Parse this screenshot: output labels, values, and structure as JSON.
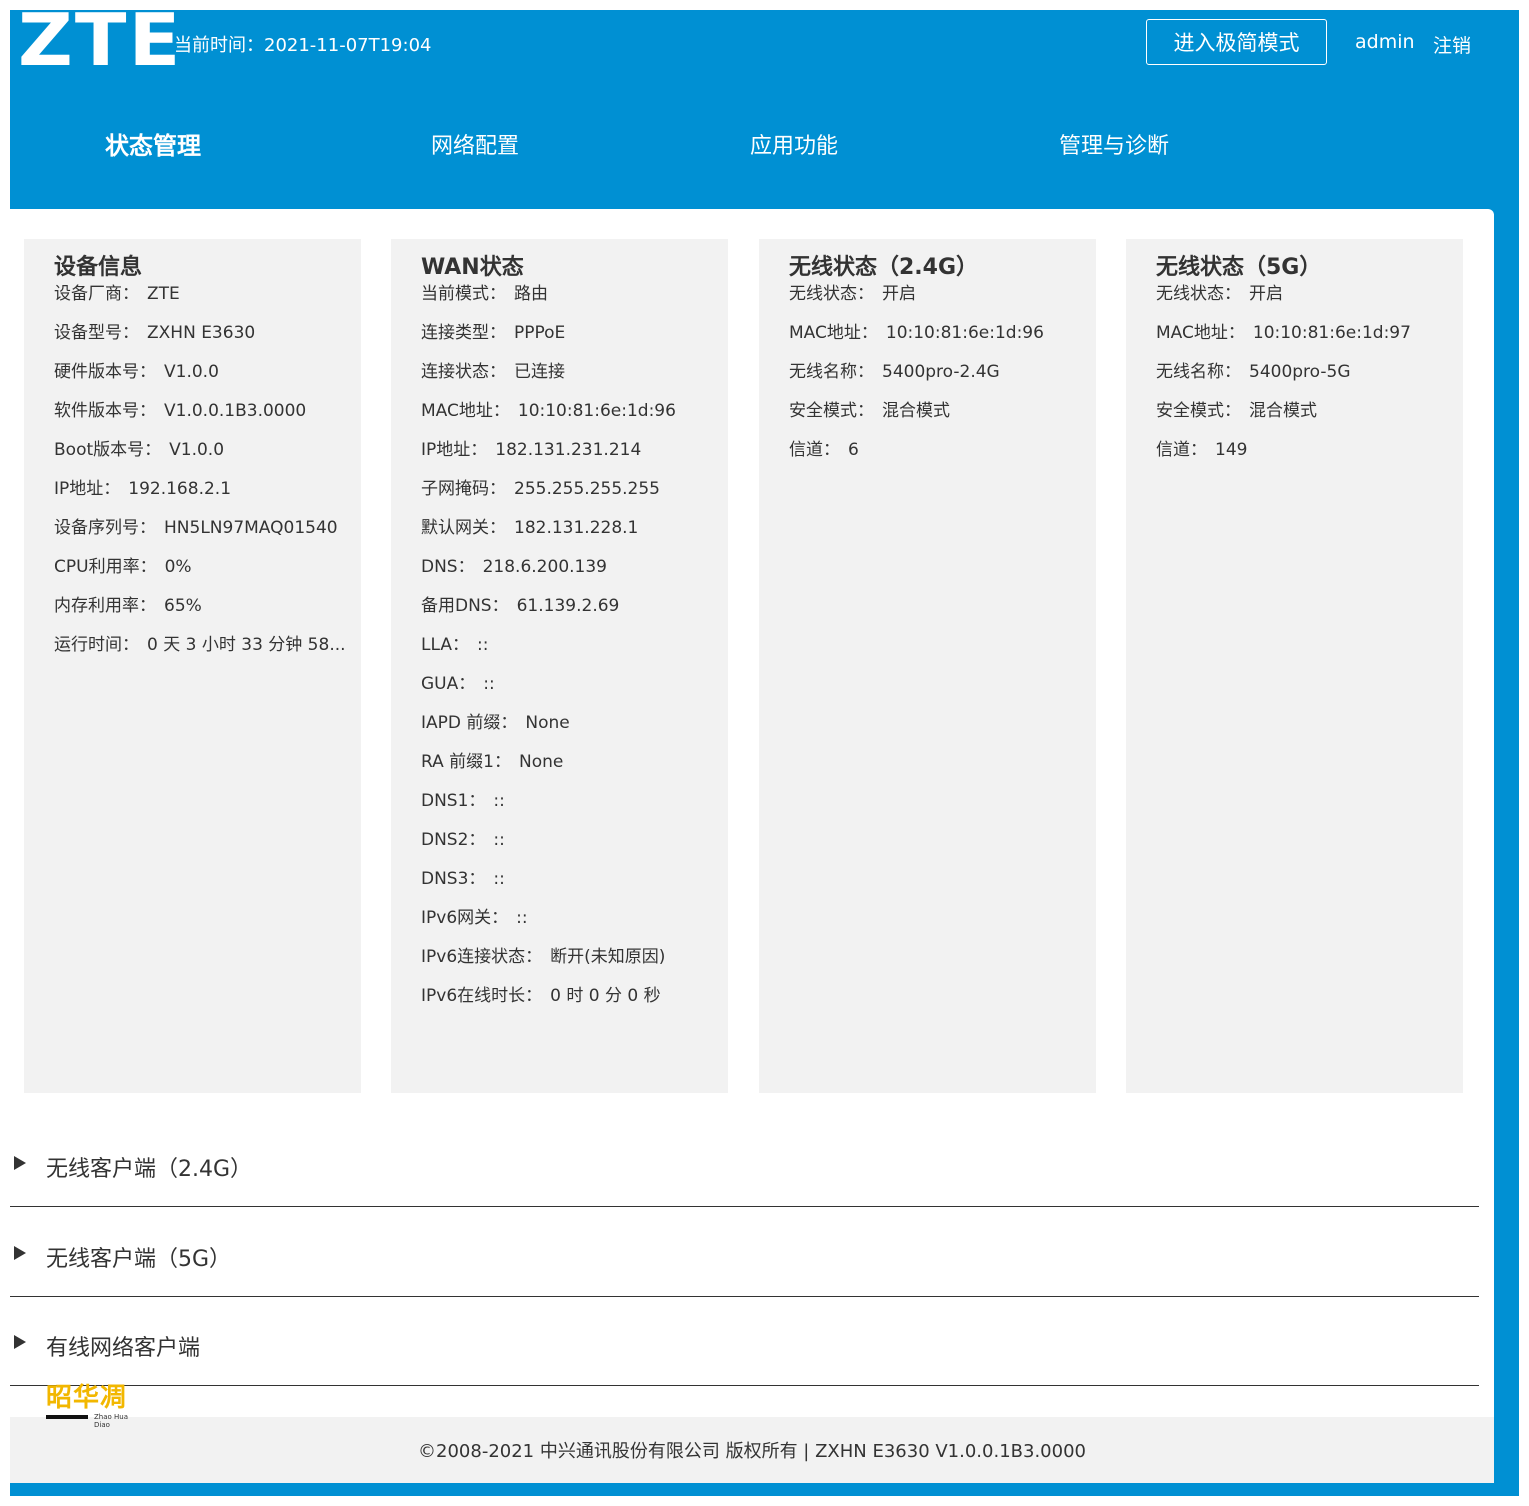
{
  "header": {
    "logo": "ZTE",
    "time_label": "当前时间：",
    "time_value": "2021-11-07T19:04",
    "simple_mode_button": "进入极简模式",
    "user": "admin",
    "logout": "注销"
  },
  "nav": [
    {
      "label": "状态管理",
      "active": true
    },
    {
      "label": "网络配置",
      "active": false
    },
    {
      "label": "应用功能",
      "active": false
    },
    {
      "label": "管理与诊断",
      "active": false
    }
  ],
  "cards": {
    "device": {
      "title": "设备信息",
      "rows": [
        {
          "label": "设备厂商：",
          "value": "ZTE"
        },
        {
          "label": "设备型号：",
          "value": "ZXHN E3630"
        },
        {
          "label": "硬件版本号：",
          "value": "V1.0.0"
        },
        {
          "label": "软件版本号：",
          "value": "V1.0.0.1B3.0000"
        },
        {
          "label": "Boot版本号：",
          "value": "V1.0.0"
        },
        {
          "label": "IP地址：",
          "value": "192.168.2.1"
        },
        {
          "label": "设备序列号：",
          "value": "HN5LN97MAQ01540"
        },
        {
          "label": "CPU利用率：",
          "value": "0%"
        },
        {
          "label": "内存利用率：",
          "value": "65%"
        },
        {
          "label": "运行时间：",
          "value": "0 天 3 小时 33 分钟 58..."
        }
      ]
    },
    "wan": {
      "title": "WAN状态",
      "rows": [
        {
          "label": "当前模式：",
          "value": "路由"
        },
        {
          "label": "连接类型：",
          "value": "PPPoE"
        },
        {
          "label": "连接状态：",
          "value": "已连接"
        },
        {
          "label": "MAC地址：",
          "value": "10:10:81:6e:1d:96"
        },
        {
          "label": "IP地址：",
          "value": "182.131.231.214"
        },
        {
          "label": "子网掩码：",
          "value": "255.255.255.255"
        },
        {
          "label": "默认网关：",
          "value": "182.131.228.1"
        },
        {
          "label": "DNS：",
          "value": "218.6.200.139"
        },
        {
          "label": "备用DNS：",
          "value": "61.139.2.69"
        },
        {
          "label": "LLA：",
          "value": "::"
        },
        {
          "label": "GUA：",
          "value": "::"
        },
        {
          "label": "IAPD 前缀：",
          "value": "None"
        },
        {
          "label": "RA 前缀1：",
          "value": "None"
        },
        {
          "label": "DNS1：",
          "value": "::"
        },
        {
          "label": "DNS2：",
          "value": "::"
        },
        {
          "label": "DNS3：",
          "value": "::"
        },
        {
          "label": "IPv6网关：",
          "value": "::"
        },
        {
          "label": "IPv6连接状态：",
          "value": "断开(未知原因)"
        },
        {
          "label": "IPv6在线时长：",
          "value": "0 时 0 分 0 秒"
        }
      ]
    },
    "wifi24": {
      "title": "无线状态（2.4G）",
      "rows": [
        {
          "label": "无线状态：",
          "value": "开启"
        },
        {
          "label": "MAC地址：",
          "value": "10:10:81:6e:1d:96"
        },
        {
          "label": "无线名称：",
          "value": "5400pro-2.4G"
        },
        {
          "label": "安全模式：",
          "value": "混合模式"
        },
        {
          "label": "信道：",
          "value": "6"
        }
      ]
    },
    "wifi5": {
      "title": "无线状态（5G）",
      "rows": [
        {
          "label": "无线状态：",
          "value": "开启"
        },
        {
          "label": "MAC地址：",
          "value": "10:10:81:6e:1d:97"
        },
        {
          "label": "无线名称：",
          "value": "5400pro-5G"
        },
        {
          "label": "安全模式：",
          "value": "混合模式"
        },
        {
          "label": "信道：",
          "value": "149"
        }
      ]
    }
  },
  "accordions": [
    {
      "title": "无线客户端（2.4G）"
    },
    {
      "title": "无线客户端（5G）"
    },
    {
      "title": "有线网络客户端"
    }
  ],
  "watermark": {
    "text": "昭华凋",
    "sub": "Zhao Hua Diao"
  },
  "footer": {
    "text": "©2008-2021 中兴通讯股份有限公司 版权所有 |  ZXHN E3630 V1.0.0.1B3.0000"
  },
  "colors": {
    "brand": "#0090d3",
    "card_bg": "#f2f2f2",
    "text": "#333333"
  }
}
